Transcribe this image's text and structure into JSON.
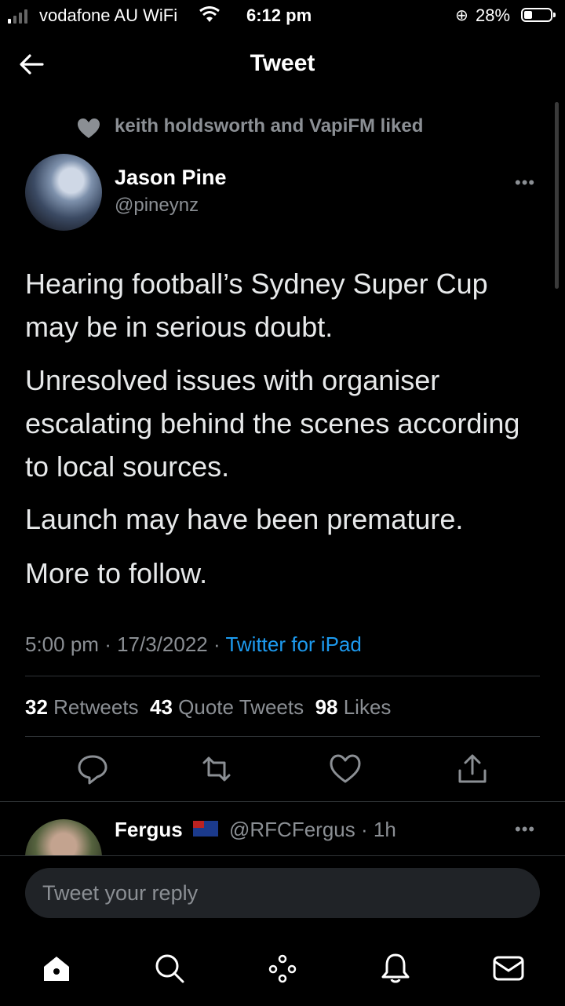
{
  "status_bar": {
    "carrier": "vodafone AU WiFi",
    "time": "6:12 pm",
    "battery": "28%",
    "signal_bars": 4,
    "signal_active": 1
  },
  "header": {
    "title": "Tweet",
    "back_icon": "back-arrow-icon"
  },
  "social_context": {
    "text": "keith holdsworth and VapiFM liked",
    "icon": "heart-icon"
  },
  "tweet": {
    "author_name": "Jason Pine",
    "author_handle": "@pineynz",
    "more_icon": "more-icon",
    "more_label": "•••",
    "paragraphs": [
      "Hearing football’s Sydney Super Cup may be in serious doubt.",
      "Unresolved issues with organiser escalating behind the scenes according to local sources.",
      "Launch may have been premature.",
      "More to follow."
    ],
    "time": "5:00 pm",
    "date": "17/3/2022",
    "separator": "·",
    "source": "Twitter for iPad"
  },
  "stats": {
    "retweets_count": "32",
    "retweets_label": "Retweets",
    "quotes_count": "43",
    "quotes_label": "Quote Tweets",
    "likes_count": "98",
    "likes_label": "Likes"
  },
  "actions": [
    "reply-icon",
    "retweet-icon",
    "like-icon",
    "share-icon"
  ],
  "reply": {
    "name": "Fergus",
    "flag": "australia-flag-icon",
    "handle": "@RFCFergus",
    "time": "1h",
    "separator": "·",
    "more_label": "•••"
  },
  "compose": {
    "placeholder": "Tweet your reply"
  },
  "bottom_nav": [
    "home-icon",
    "search-icon",
    "spaces-icon",
    "notifications-icon",
    "messages-icon"
  ],
  "colors": {
    "background": "#000000",
    "text": "#e7e9ea",
    "secondary": "#8b8f94",
    "link": "#1d9bf0"
  }
}
